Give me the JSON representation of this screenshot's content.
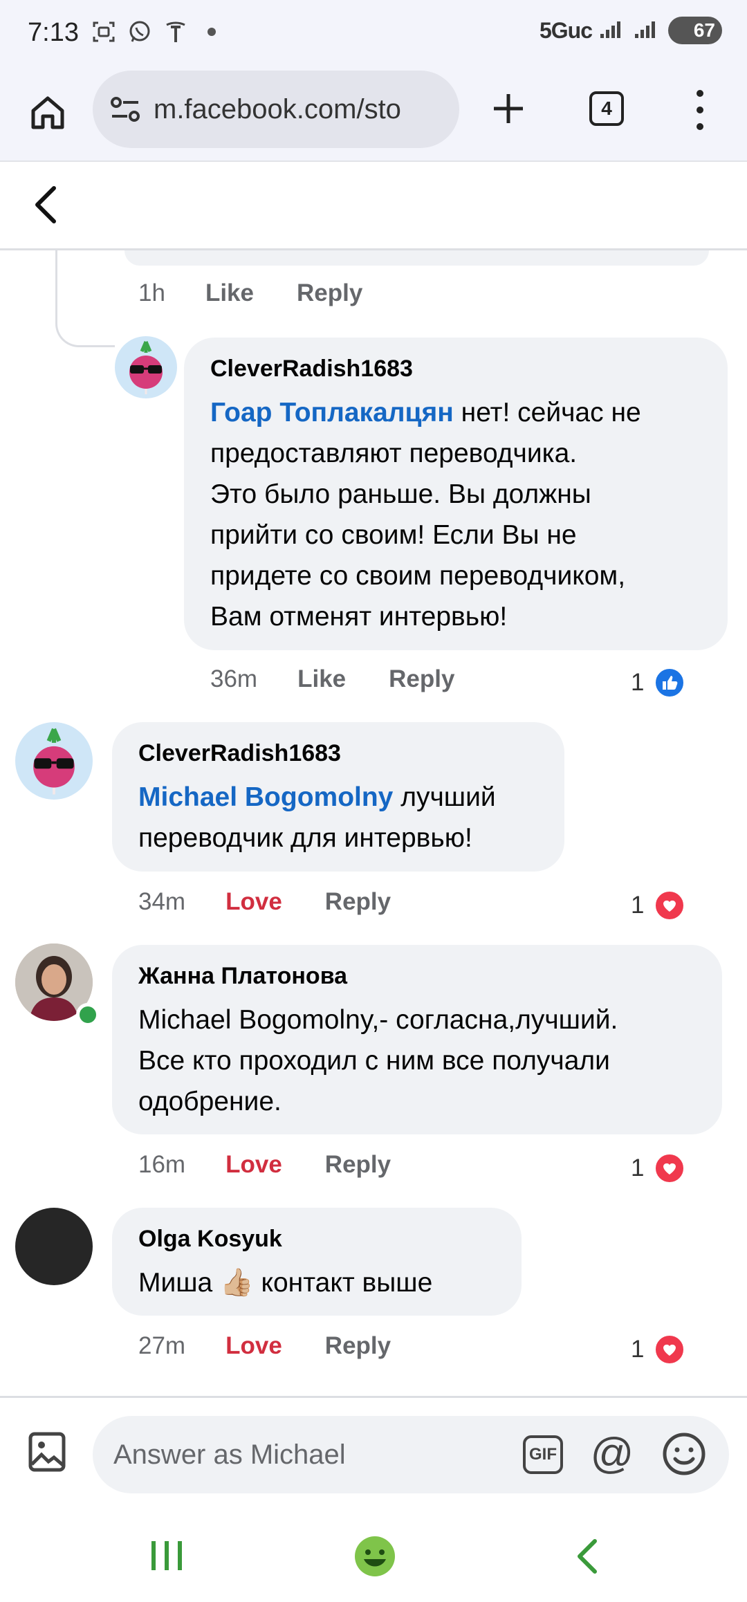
{
  "status_bar": {
    "time": "7:13",
    "network": "5Guc",
    "battery": "67"
  },
  "browser": {
    "url": "m.facebook.com/sto",
    "tab_count": "4"
  },
  "comments": [
    {
      "id": "parent",
      "time": "1h",
      "actions": [
        "Like",
        "Reply"
      ]
    },
    {
      "id": "c1",
      "author": "CleverRadish1683",
      "mention": "Гоар Топлакалцян",
      "lines": [
        " нет! сейчас не",
        "предоставляют переводчика.",
        "Это было раньше. Вы должны",
        "прийти со своим! Если Вы не",
        "придете со своим переводчиком,",
        "Вам отменят интервью!"
      ],
      "time": "36m",
      "action": "Like",
      "reply": "Reply",
      "reaction_count": "1",
      "reaction": "like"
    },
    {
      "id": "c2",
      "author": "CleverRadish1683",
      "mention": "Michael Bogomolny",
      "lines": [
        " лучший",
        "переводчик для интервью!"
      ],
      "time": "34m",
      "action": "Love",
      "reply": "Reply",
      "reaction_count": "1",
      "reaction": "love"
    },
    {
      "id": "c3",
      "author": "Жанна Платонова",
      "lines": [
        "Michael Bogomolny,- согласна,лучший.",
        "Все кто проходил с ним все получали",
        "одобрение."
      ],
      "time": "16m",
      "action": "Love",
      "reply": "Reply",
      "reaction_count": "1",
      "reaction": "love"
    },
    {
      "id": "c4",
      "author": "Olga Kosyuk",
      "text_before": "Миша ",
      "emoji": "👍🏼",
      "text_after": " контакт выше",
      "time": "27m",
      "action": "Love",
      "reply": "Reply",
      "reaction_count": "1",
      "reaction": "love"
    }
  ],
  "composer": {
    "placeholder": "Answer as Michael",
    "gif_label": "GIF",
    "at_symbol": "@"
  },
  "colors": {
    "mention": "#1567c4",
    "love": "#d12e3f",
    "like_badge": "#1b74e4",
    "nav_green": "#3a9a3a"
  }
}
